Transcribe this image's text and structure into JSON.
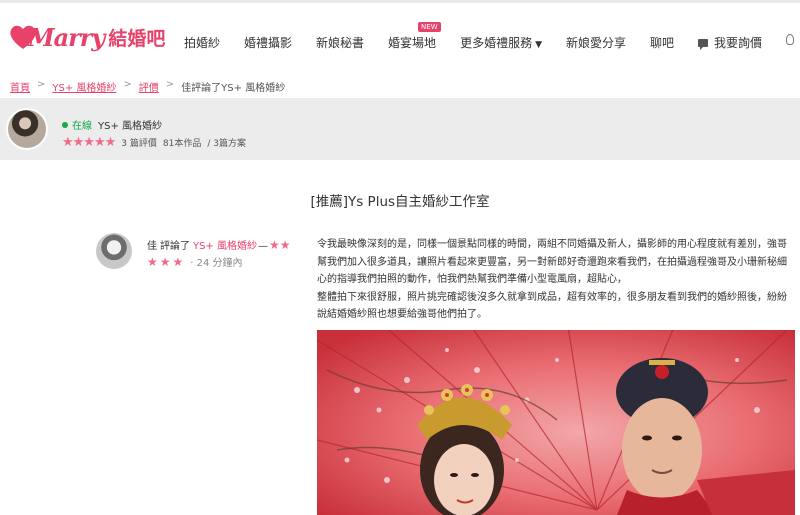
{
  "brand": {
    "script": "Marry",
    "cn": "結婚吧",
    "color": "#e8426b"
  },
  "nav": {
    "items": [
      "拍婚紗",
      "婚禮攝影",
      "新娘秘書",
      "婚宴場地",
      "更多婚禮服務",
      "新娘愛分享",
      "聊吧"
    ],
    "new_badge": "NEW",
    "caret": "▼",
    "inquiry": "我要詢價"
  },
  "breadcrumb": {
    "items": [
      "首頁",
      "YS+ 風格婚紗",
      "評價",
      "佳評論了YS+ 風格婚紗"
    ],
    "sep": ">"
  },
  "vendor": {
    "online": "在線",
    "name": "YS+ 風格婚紗",
    "stars": "★★★★★",
    "reviews": "3 篇評價",
    "works": "81本作品",
    "plans": "/ 3篇方案"
  },
  "article": {
    "title": "[推薦]Ys Plus自主婚紗工作室"
  },
  "reviewer": {
    "user": "佳",
    "verb": "評論了",
    "vendor": "YS+ 風格婚紗",
    "dash": "—",
    "stars_a": "★★",
    "stars_b": "★★★",
    "time": "· 24 分鐘內"
  },
  "review": {
    "p1": "令我最映像深刻的是，同樣一個景點同樣的時間，兩組不同婚攝及新人，攝影師的用心程度就有差別，強哥幫我們加入很多道具，讓照片看起來更豐富，另一對新郎好奇還跑來看我們，在拍攝過程強哥及小珊新秘細心的指導我們拍照的動作，怕我們熱幫我們準備小型電風扇，超貼心，",
    "p2": "整體拍下來很舒服，照片挑完確認後沒多久就拿到成品，超有效率的，很多朋友看到我們的婚紗照後，紛紛說結婚婚紗照也想要給強哥他們拍了。"
  },
  "colors": {
    "accent": "#e8426b",
    "online": "#19a84b",
    "stars": "#ef6b87",
    "vendor_bar": "#ececec"
  }
}
